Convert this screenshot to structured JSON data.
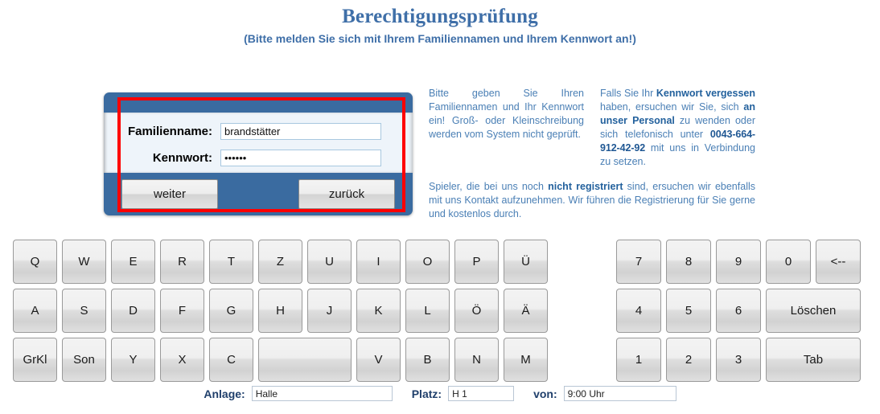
{
  "header": {
    "title": "Berechtigungsprüfung",
    "subtitle": "(Bitte melden Sie sich mit Ihrem Familiennamen und Ihrem Kennwort an!)"
  },
  "login": {
    "familienname_label": "Familienname:",
    "familienname_value": "brandstätter",
    "kennwort_label": "Kennwort:",
    "kennwort_value": "••••••",
    "weiter_label": "weiter",
    "zurueck_label": "zurück",
    "highlight_color": "#ff0000",
    "panel_color": "#3a6ba0"
  },
  "info": {
    "col1_plain_1": "Bitte geben Sie Ihren Familiennamen und Ihr Kennwort ein! Groß- oder Kleinschreibung werden vom System nicht geprüft.",
    "col2_plain_1": "Falls Sie Ihr ",
    "col2_bold_1": "Kennwort vergessen",
    "col2_plain_2": " haben, ersuchen wir Sie, sich ",
    "col2_bold_2": "an unser Personal",
    "col2_plain_3": " zu wenden oder sich telefonisch unter ",
    "col2_phone": "0043-664-912-42-92",
    "col2_plain_4": " mit uns in Verbindung zu setzen.",
    "note_plain_1": "Spieler, die bei uns noch ",
    "note_bold_1": "nicht registriert",
    "note_plain_2": " sind, ersuchen wir ebenfalls mit uns Kontakt aufzunehmen. Wir führen die Registrierung für Sie gerne und kostenlos durch.",
    "text_color": "#4a7fb5"
  },
  "keyboard": {
    "rows": [
      [
        "Q",
        "W",
        "E",
        "R",
        "T",
        "Z",
        "U",
        "I",
        "O",
        "P",
        "Ü"
      ],
      [
        "A",
        "S",
        "D",
        "F",
        "G",
        "H",
        "J",
        "K",
        "L",
        "Ö",
        "Ä"
      ],
      [
        "GrKl",
        "Son",
        "Y",
        "X",
        "C",
        "",
        "V",
        "B",
        "N",
        "M"
      ]
    ],
    "spacebar_index": 5,
    "spacebar_label": ""
  },
  "numpad": {
    "rows": [
      [
        "7",
        "8",
        "9",
        "0",
        "<--"
      ],
      [
        "4",
        "5",
        "6",
        "Löschen"
      ],
      [
        "1",
        "2",
        "3",
        "Tab"
      ]
    ],
    "wide_keys": [
      "Löschen",
      "Tab"
    ]
  },
  "bottom": {
    "anlage_label": "Anlage:",
    "anlage_value": "Halle",
    "platz_label": "Platz:",
    "platz_value": "H 1",
    "von_label": "von:",
    "von_value": "9:00 Uhr"
  }
}
